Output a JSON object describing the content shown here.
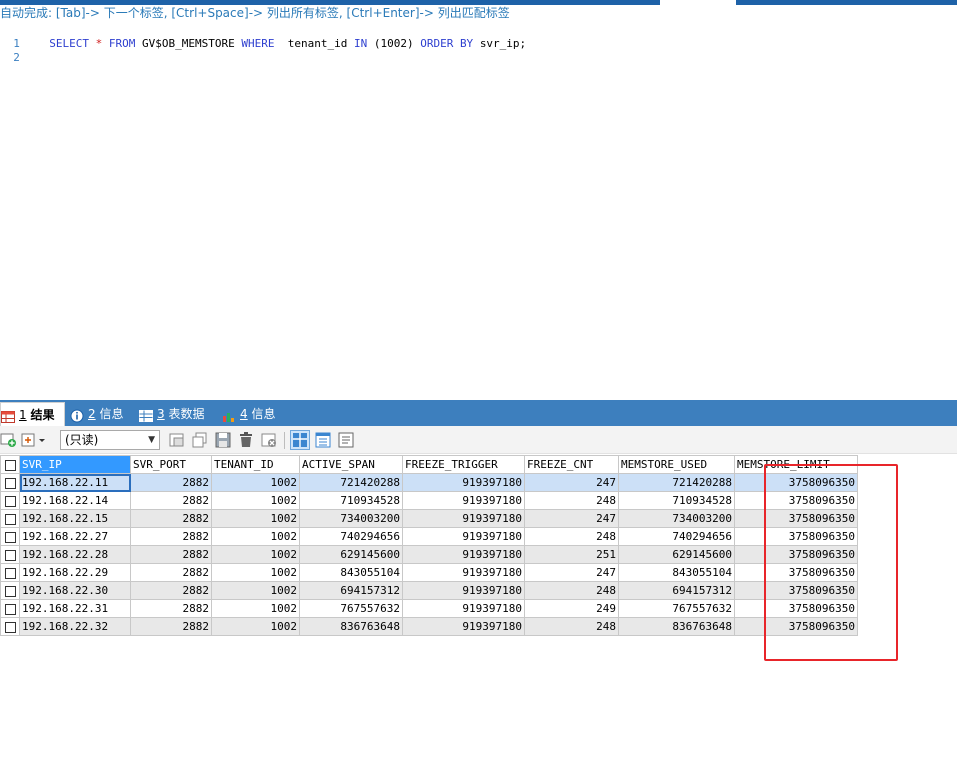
{
  "colors": {
    "tabbar": "#3d7fbe",
    "header_highlight": "#3399ff",
    "annotation": "#e8252a",
    "keyword": "#2e3fcf"
  },
  "editor": {
    "hint": "自动完成: [Tab]-> 下一个标签, [Ctrl+Space]-> 列出所有标签, [Ctrl+Enter]-> 列出匹配标签",
    "lines": [
      {
        "number": "1",
        "tokens": [
          "SELECT",
          "*",
          "FROM",
          "GV$OB_MEMSTORE",
          "WHERE",
          "tenant_id",
          "IN",
          "(1002)",
          "ORDER BY",
          "svr_ip;"
        ]
      },
      {
        "number": "2"
      }
    ]
  },
  "result_tabs": [
    {
      "num": "1",
      "label": "结果",
      "icon": "grid-result-icon",
      "active": true
    },
    {
      "num": "2",
      "label": "信息",
      "icon": "info-icon",
      "active": false
    },
    {
      "num": "3",
      "label": "表数据",
      "icon": "table-data-icon",
      "active": false
    },
    {
      "num": "4",
      "label": "信息",
      "icon": "chart-info-icon",
      "active": false
    }
  ],
  "toolbar": {
    "mode_select": "(只读)",
    "icons": [
      "add-row-icon",
      "export-dropdown-icon",
      "filter-icon",
      "copy-icon",
      "save-icon",
      "delete-icon",
      "refresh-icon",
      "grid-view-icon",
      "form-view-icon",
      "text-view-icon"
    ]
  },
  "grid": {
    "columns": [
      "SVR_IP",
      "SVR_PORT",
      "TENANT_ID",
      "ACTIVE_SPAN",
      "FREEZE_TRIGGER",
      "FREEZE_CNT",
      "MEMSTORE_USED",
      "MEMSTORE_LIMIT"
    ],
    "rows": [
      [
        "192.168.22.11",
        "2882",
        "1002",
        "721420288",
        "919397180",
        "247",
        "721420288",
        "3758096350"
      ],
      [
        "192.168.22.14",
        "2882",
        "1002",
        "710934528",
        "919397180",
        "248",
        "710934528",
        "3758096350"
      ],
      [
        "192.168.22.15",
        "2882",
        "1002",
        "734003200",
        "919397180",
        "247",
        "734003200",
        "3758096350"
      ],
      [
        "192.168.22.27",
        "2882",
        "1002",
        "740294656",
        "919397180",
        "248",
        "740294656",
        "3758096350"
      ],
      [
        "192.168.22.28",
        "2882",
        "1002",
        "629145600",
        "919397180",
        "251",
        "629145600",
        "3758096350"
      ],
      [
        "192.168.22.29",
        "2882",
        "1002",
        "843055104",
        "919397180",
        "247",
        "843055104",
        "3758096350"
      ],
      [
        "192.168.22.30",
        "2882",
        "1002",
        "694157312",
        "919397180",
        "248",
        "694157312",
        "3758096350"
      ],
      [
        "192.168.22.31",
        "2882",
        "1002",
        "767557632",
        "919397180",
        "249",
        "767557632",
        "3758096350"
      ],
      [
        "192.168.22.32",
        "2882",
        "1002",
        "836763648",
        "919397180",
        "248",
        "836763648",
        "3758096350"
      ]
    ]
  }
}
